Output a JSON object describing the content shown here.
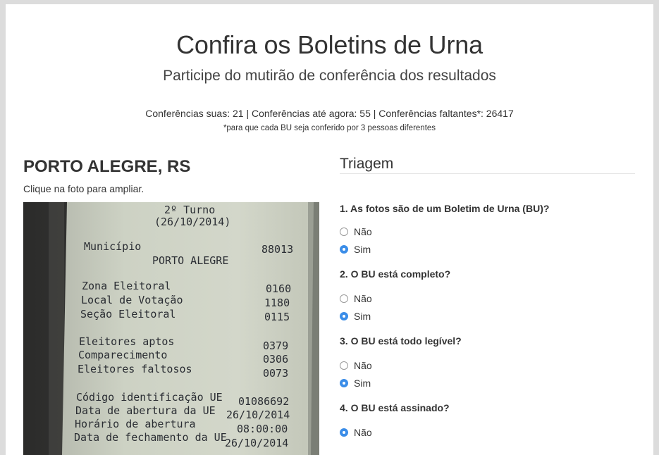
{
  "header": {
    "title": "Confira os Boletins de Urna",
    "subtitle": "Participe do mutirão de conferência dos resultados",
    "stats": "Conferências suas: 21 | Conferências até agora: 55 | Conferências faltantes*: 26417",
    "note": "*para que cada BU seja conferido por 3 pessoas diferentes"
  },
  "left": {
    "city": "PORTO ALEGRE, RS",
    "hint": "Clique na foto para ampliar.",
    "receipt": {
      "turno": "2º Turno",
      "date": "(26/10/2014)",
      "municipio_label": "Município",
      "municipio_code": "88013",
      "municipio_name": "PORTO ALEGRE",
      "zona_label": "Zona Eleitoral",
      "zona_value": "0160",
      "local_label": "Local de Votação",
      "local_value": "1180",
      "secao_label": "Seção Eleitoral",
      "secao_value": "0115",
      "aptos_label": "Eleitores aptos",
      "aptos_value": "0379",
      "comparecimento_label": "Comparecimento",
      "comparecimento_value": "0306",
      "faltosos_label": "Eleitores faltosos",
      "faltosos_value": "0073",
      "codigo_label": "Código identificação UE",
      "codigo_value": "01086692",
      "abertura_label": "Data de abertura da UE",
      "abertura_value": "26/10/2014",
      "horario_label": "Horário de abertura",
      "horario_value": "08:00:00",
      "fechamento_label": "Data de fechamento da UE",
      "fechamento_value": "26/10/2014"
    }
  },
  "triagem": {
    "title": "Triagem",
    "questions": [
      {
        "label": "1. As fotos são de um Boletim de Urna (BU)?",
        "options": [
          {
            "label": "Não",
            "checked": false
          },
          {
            "label": "Sim",
            "checked": true
          }
        ]
      },
      {
        "label": "2. O BU está completo?",
        "options": [
          {
            "label": "Não",
            "checked": false
          },
          {
            "label": "Sim",
            "checked": true
          }
        ]
      },
      {
        "label": "3. O BU está todo legível?",
        "options": [
          {
            "label": "Não",
            "checked": false
          },
          {
            "label": "Sim",
            "checked": true
          }
        ]
      },
      {
        "label": "4. O BU está assinado?",
        "options": [
          {
            "label": "Não",
            "checked": true
          }
        ]
      }
    ]
  },
  "colors": {
    "background": "#dcdcdc",
    "card": "#ffffff",
    "text": "#333333",
    "radio_selected": "#3b8de8"
  }
}
